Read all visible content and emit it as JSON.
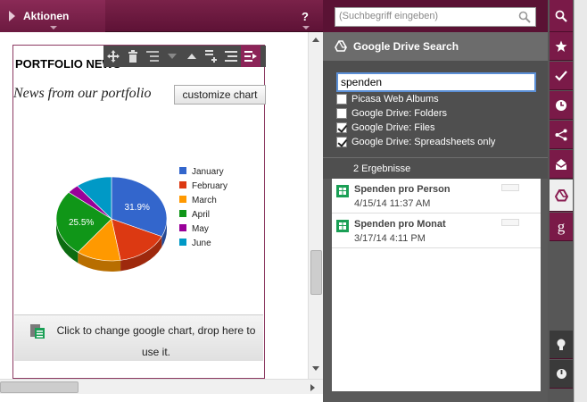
{
  "topbar": {
    "actions_label": "Aktionen",
    "help_label": "?"
  },
  "portlet": {
    "title": "PORTFOLIO NEWS",
    "subtitle": "News from our portfolio",
    "customize_label": "customize chart",
    "dropzone_text": "Click to change google chart, drop here to use it.",
    "toolbar_icons": [
      "move-icon",
      "delete-icon",
      "indent-icon",
      "arrow-down-icon",
      "arrow-up-icon",
      "add-row-icon",
      "align-icon",
      "format-icon"
    ]
  },
  "chart_data": {
    "type": "pie",
    "categories": [
      "January",
      "February",
      "March",
      "April",
      "May",
      "June"
    ],
    "values": [
      31.9,
      15.5,
      13.0,
      25.5,
      3.5,
      10.6
    ],
    "colors": [
      "#3366cc",
      "#dc3912",
      "#ff9900",
      "#109618",
      "#990099",
      "#0099c6"
    ],
    "data_labels": [
      "31.9%",
      "",
      "",
      "25.5%",
      "",
      ""
    ],
    "legend": "right"
  },
  "panel": {
    "search_placeholder": "(Suchbegriff eingeben)",
    "title": "Google Drive Search",
    "query_value": "spenden",
    "filters": [
      {
        "label": "Picasa Web Albums",
        "checked": false
      },
      {
        "label": "Google Drive: Folders",
        "checked": false
      },
      {
        "label": "Google Drive: Files",
        "checked": true
      },
      {
        "label": "Google Drive: Spreadsheets only",
        "checked": true
      }
    ],
    "results_count": "2 Ergebnisse",
    "results": [
      {
        "name": "Spenden pro Person",
        "date": "4/15/14 11:37 AM"
      },
      {
        "name": "Spenden pro Monat",
        "date": "3/17/14 4:11 PM"
      }
    ]
  },
  "strip": {
    "icons": [
      "search-icon",
      "star-icon",
      "check-icon",
      "clock-icon",
      "share-icon",
      "inbox-icon",
      "google-drive-icon",
      "google-plus-icon"
    ],
    "bottom_icons": [
      "lightbulb-icon",
      "power-icon"
    ],
    "gplus_glyph": "g"
  }
}
